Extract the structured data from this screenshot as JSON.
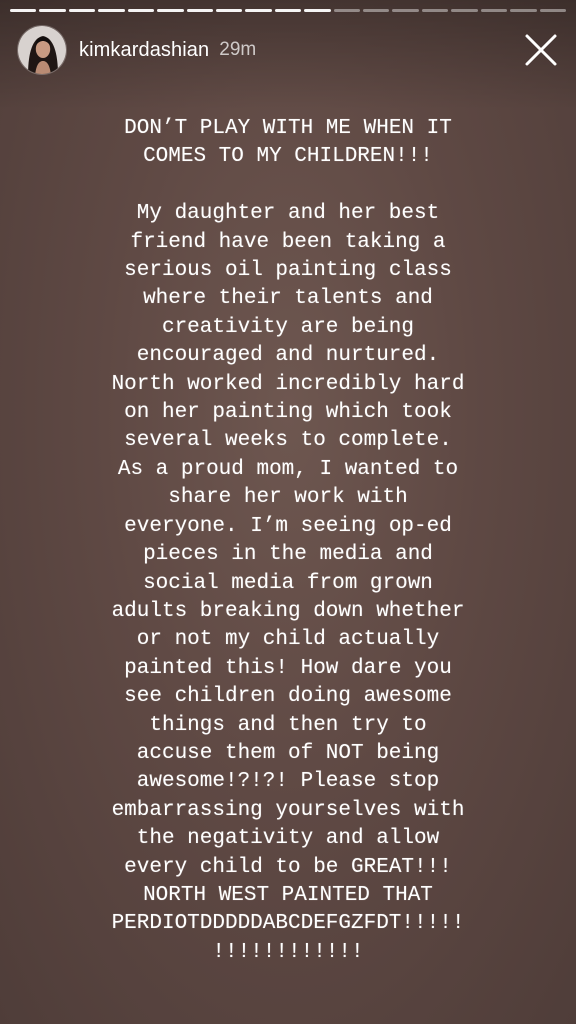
{
  "story": {
    "segments_total": 19,
    "segments_completed": 11,
    "username": "kimkardashian",
    "timestamp": "29m",
    "close_icon": "close-icon",
    "colors": {
      "background": "#5f4944",
      "text": "#ffffff"
    },
    "text": "DON’T PLAY WITH ME WHEN IT\nCOMES TO MY CHILDREN!!!\n\nMy daughter and her best\nfriend have been taking a\nserious oil painting class\nwhere their talents and\ncreativity are being\nencouraged and nurtured.\nNorth worked incredibly hard\non her painting which took\nseveral weeks to complete.\nAs a proud mom, I wanted to\nshare her work with\neveryone. I’m seeing op-ed\npieces in the media and\nsocial media from grown\nadults breaking down whether\nor not my child actually\npainted this! How dare you\nsee children doing awesome\nthings and then try to\naccuse them of NOT being\nawesome!?!?!  Please stop\nembarrassing yourselves with\nthe negativity and allow\nevery child to be GREAT!!!\nNORTH WEST PAINTED THAT\nPERDIOTDDDDDABCDEFGZFDT!!!!!\n!!!!!!!!!!!!"
  }
}
